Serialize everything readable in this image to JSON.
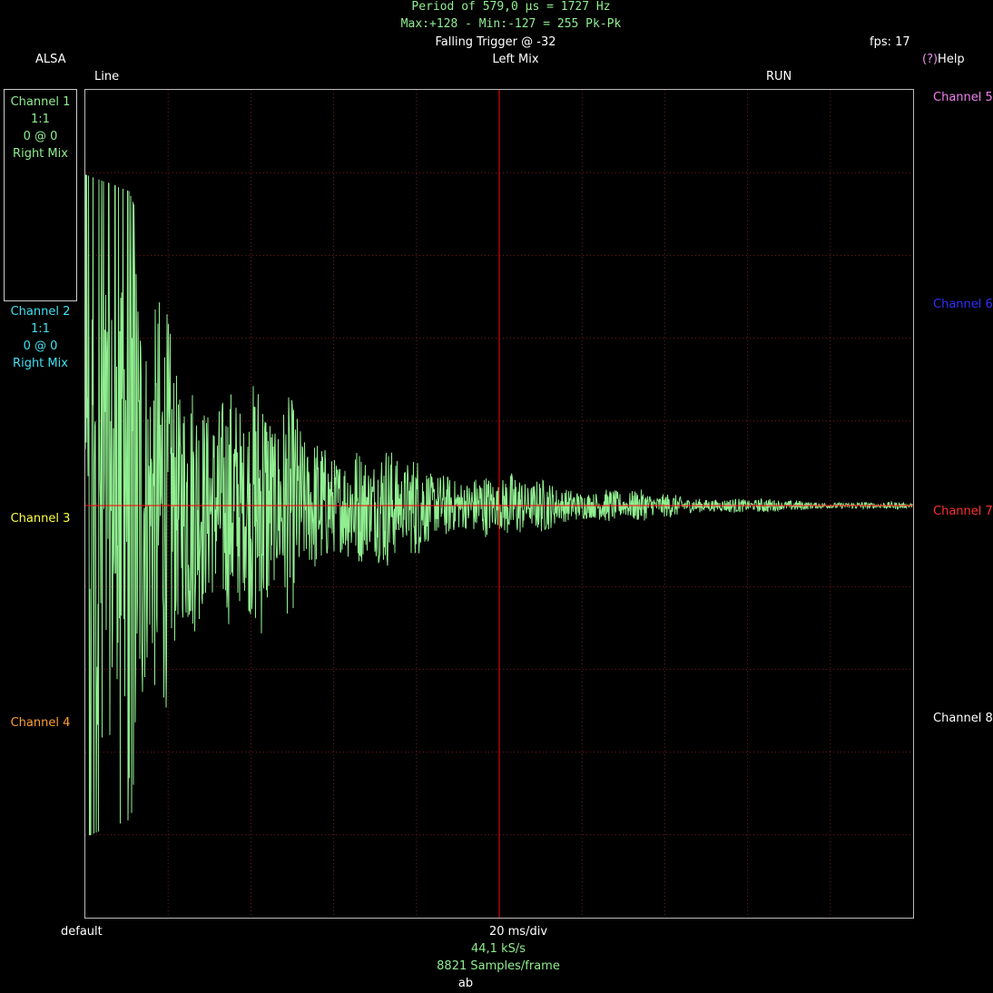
{
  "header": {
    "period_line": "Period of 579,0 µs =  1727 Hz",
    "maxmin_line": "Max:+128 - Min:-127 = 255 Pk-Pk",
    "trigger": "Falling Trigger @ -32",
    "fps": "fps: 17",
    "source": "ALSA",
    "mix": "Left Mix",
    "help_q": "(?)",
    "help": "Help",
    "line": "Line",
    "run_state": "RUN"
  },
  "channels_left": [
    {
      "name": "Channel 1",
      "scale": "1:1",
      "offset": "0 @ 0",
      "source": "Right Mix",
      "color": "#90ee90",
      "selected": true
    },
    {
      "name": "Channel 2",
      "scale": "1:1",
      "offset": "0 @ 0",
      "source": "Right Mix",
      "color": "#40e0f0"
    },
    {
      "name": "Channel 3",
      "color": "#ffff40"
    },
    {
      "name": "Channel 4",
      "color": "#ffa030"
    }
  ],
  "channels_right": [
    {
      "name": "Channel 5",
      "color": "#ee82ee"
    },
    {
      "name": "Channel 6",
      "color": "#3030ff"
    },
    {
      "name": "Channel 7",
      "color": "#ff3030"
    },
    {
      "name": "Channel 8",
      "color": "#ffffff"
    }
  ],
  "footer": {
    "preset": "default",
    "timebase": "20 ms/div",
    "sample_rate": "44,1 kS/s",
    "samples": "8821 Samples/frame",
    "mode": "ab"
  },
  "colors": {
    "trace": "#90ee90",
    "grid": "#7a1a1a",
    "trigger_line": "#ff0000",
    "background": "#000000"
  },
  "chart_data": {
    "type": "line",
    "grid_divisions": [
      10,
      10
    ],
    "grid": true,
    "series": [
      {
        "values": [
          1.0,
          0.95,
          0.6,
          0.5,
          0.42,
          0.32,
          0.24,
          0.19,
          0.15,
          0.12,
          0.1,
          0.08,
          0.06,
          0.045,
          0.035,
          0.025,
          0.02,
          0.015,
          0.012,
          0.01
        ]
      }
    ]
  }
}
